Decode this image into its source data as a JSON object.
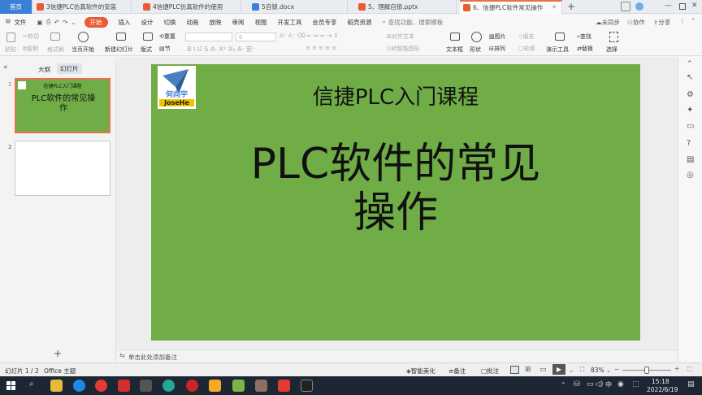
{
  "tabs": [
    {
      "label": "首页"
    },
    {
      "label": "3信捷PLC仿真软件的安装"
    },
    {
      "label": "4信捷PLC仿真软件的使用"
    },
    {
      "label": "5自锁.docx"
    },
    {
      "label": "5、理解自锁.pptx"
    },
    {
      "label": "6、信捷PLC软件常见操作"
    }
  ],
  "menu": {
    "file": "文件",
    "items": [
      "开始",
      "插入",
      "设计",
      "切换",
      "动画",
      "放映",
      "审阅",
      "视图",
      "开发工具",
      "会员专享",
      "稻壳资源"
    ],
    "search_placeholder": "查找功能、搜索模板",
    "sync": "未同步",
    "collab": "协作",
    "share": "分享"
  },
  "ribbon": {
    "paste": "粘贴",
    "cut": "剪切",
    "copy": "复制",
    "format_painter": "格式刷",
    "from_current": "当页开始",
    "new_slide": "新建幻灯片",
    "layout": "版式",
    "section": "节",
    "reset": "重置",
    "font_size": "0",
    "align_text": "对齐文本",
    "convert_smartart": "转智能图形",
    "textbox": "文本框",
    "shape": "形状",
    "arrange": "排列",
    "picture": "图片",
    "fill": "填充",
    "outline": "轮廓",
    "presenter_tools": "演示工具",
    "find": "查找",
    "replace": "替换",
    "select": "选择"
  },
  "panel": {
    "outline_tab": "大纲",
    "slides_tab": "幻灯片",
    "thumb1_title": "信捷PLC入门课程",
    "thumb1_main": "PLC软件的常见操作",
    "num1": "1",
    "num2": "2",
    "add": "+"
  },
  "slide": {
    "logo_line1": "何向宇",
    "logo_line2": "JoseHe",
    "title": "信捷PLC入门课程",
    "main_line1": "PLC软件的常见",
    "main_line2": "操作"
  },
  "notes_placeholder": "单击此处添加备注",
  "status": {
    "slide_counter": "幻灯片 1 / 2",
    "theme": "Office 主题",
    "beautify": "智能美化",
    "notes": "备注",
    "comments": "批注",
    "zoom": "83%"
  },
  "taskbar": {
    "time": "15:18",
    "date": "2022/6/19",
    "ime": "中"
  },
  "colors": {
    "slide_bg": "#70ad47",
    "accent": "#e85b33",
    "home_tab": "#3a7fd6"
  }
}
